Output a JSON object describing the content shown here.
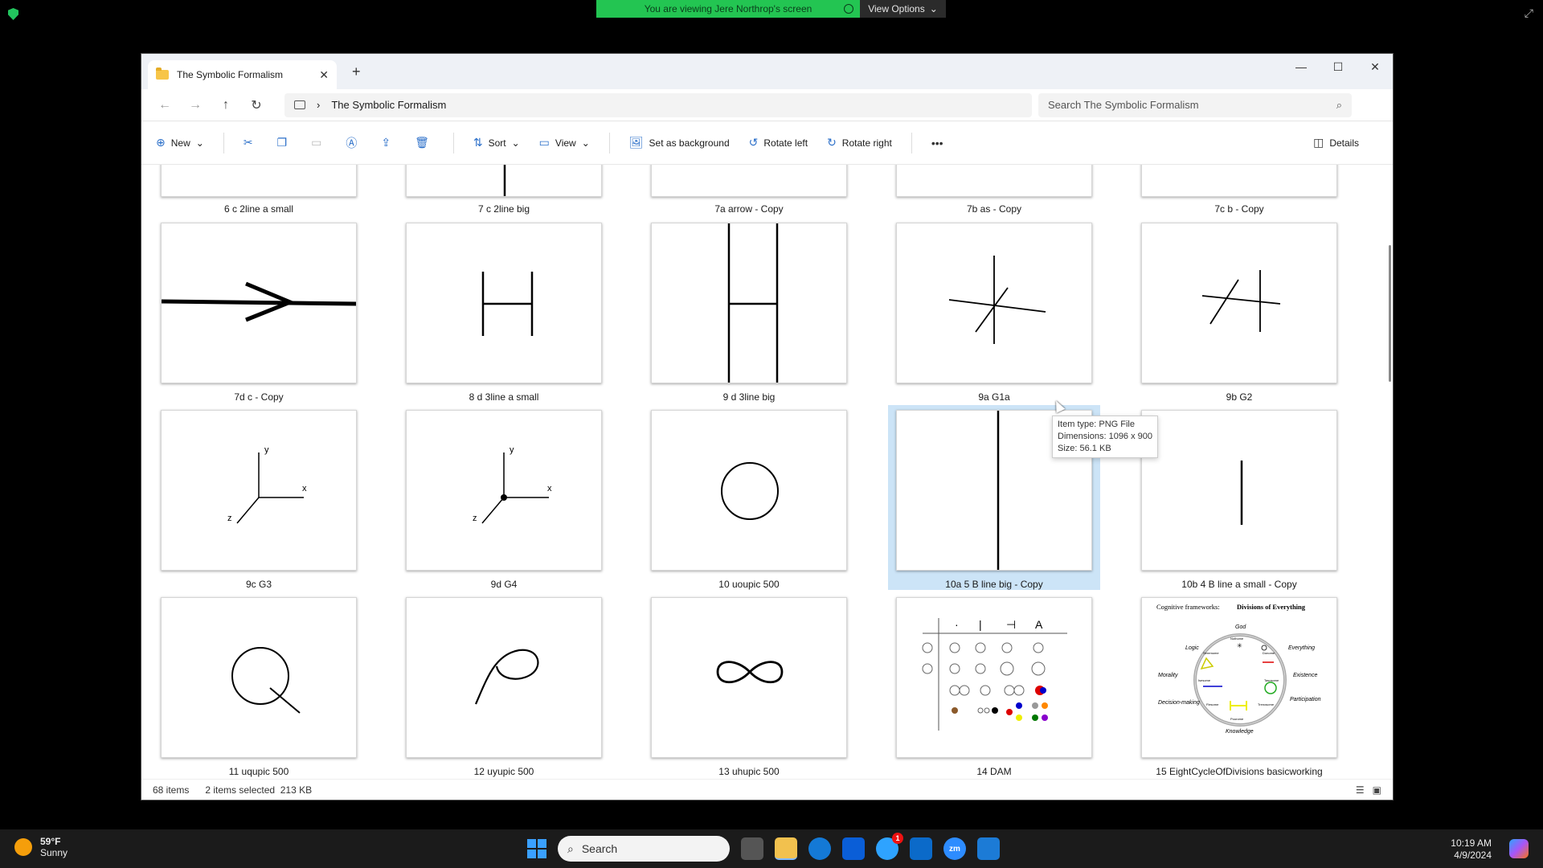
{
  "share_banner": {
    "message": "You are viewing Jere Northrop's screen",
    "options": "View Options"
  },
  "window": {
    "tab_title": "The Symbolic Formalism",
    "path": "The Symbolic Formalism",
    "search_placeholder": "Search The Symbolic Formalism"
  },
  "commands": {
    "new": "New",
    "sort": "Sort",
    "view": "View",
    "set_bg": "Set as background",
    "rotate_left": "Rotate left",
    "rotate_right": "Rotate right",
    "details": "Details"
  },
  "files": {
    "row0": [
      "6 c 2line a small",
      "7 c 2line big",
      "7a arrow - Copy",
      "7b as - Copy",
      "7c b - Copy"
    ],
    "row1": [
      "7d c - Copy",
      "8 d 3line a small",
      "9 d 3line big",
      "9a G1a",
      "9b G2"
    ],
    "row2": [
      "9c G3",
      "9d G4",
      "10 uoupic 500",
      "10a 5 B line big - Copy",
      "10b 4 B line a small - Copy"
    ],
    "row3": [
      "11 uqupic 500",
      "12 uyupic 500",
      "13 uhupic 500",
      "14 DAM",
      "15 EightCycleOfDivisions basicworking"
    ]
  },
  "thumbs": {
    "axis_y": "y",
    "axis_x": "x",
    "axis_z": "z",
    "dam_header": [
      "·",
      "|",
      "⊣",
      "A"
    ],
    "cf_title": "Cognitive frameworks:",
    "cf_bold": "Divisions of Everything",
    "cf_labels": [
      "God",
      "Logic",
      "Everything",
      "Morality",
      "Existence",
      "Decision-making",
      "Participation",
      "Knowledge"
    ],
    "cf_inner": [
      "Nothome",
      "Seremome",
      "Donome",
      "Isesome",
      "Tasosome",
      "Flesome",
      "Trenosome",
      "Pourome"
    ]
  },
  "tooltip": {
    "type": "Item type: PNG File",
    "dims": "Dimensions: 1096 x 900",
    "size": "Size: 56.1 KB"
  },
  "status": {
    "count": "68 items",
    "selected": "2 items selected",
    "size": "213 KB"
  },
  "taskbar": {
    "temp": "59°F",
    "cond": "Sunny",
    "search": "Search",
    "time": "10:19 AM",
    "date": "4/9/2024",
    "badge": "1",
    "zoom": "zm"
  }
}
